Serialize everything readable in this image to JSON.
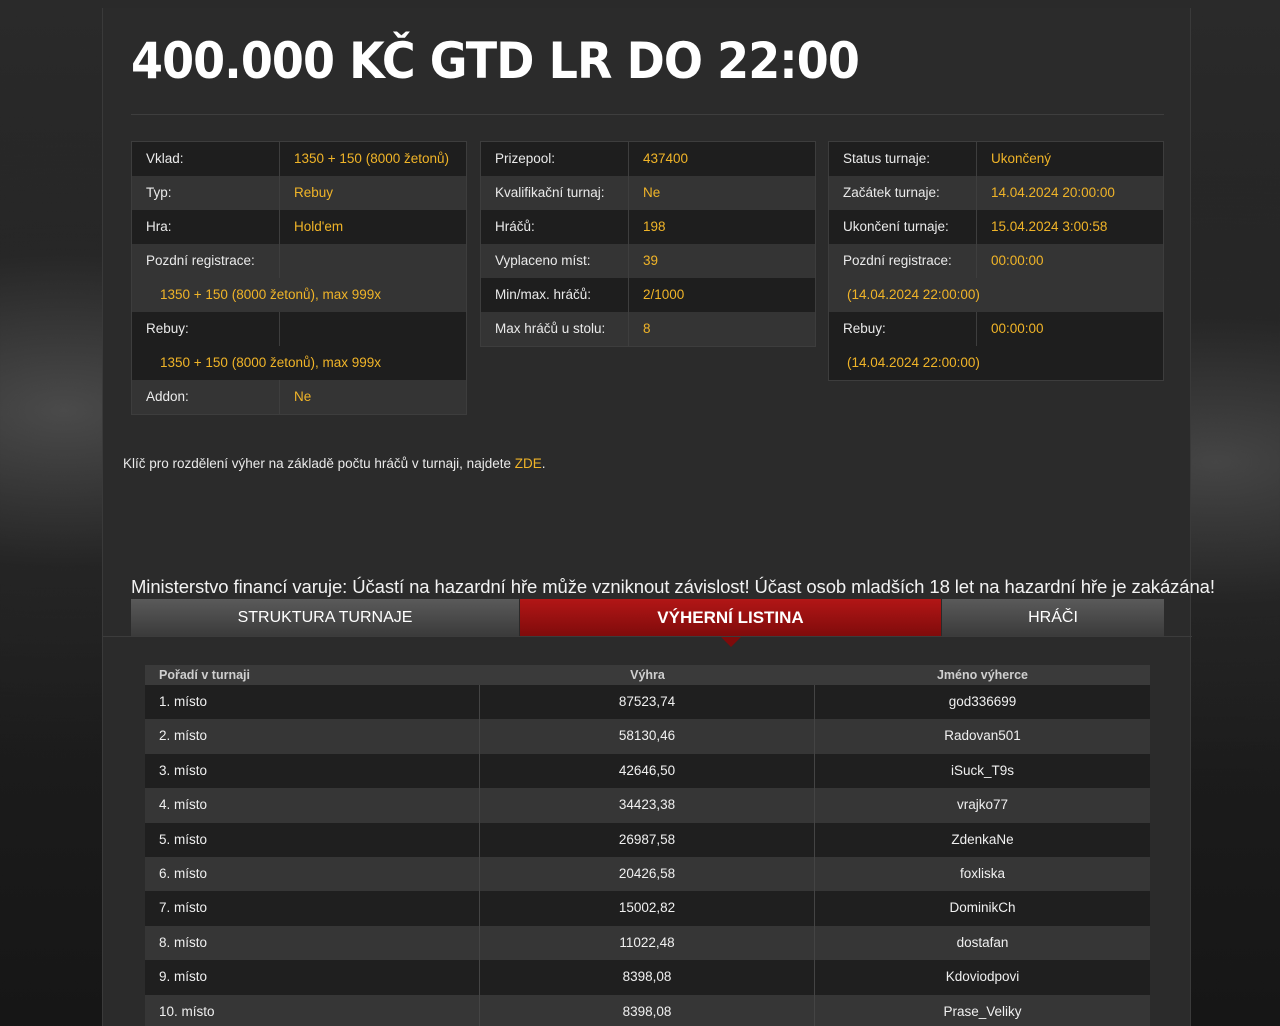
{
  "title": "400.000 KČ GTD LR DO 22:00",
  "info_left": {
    "vklad_label": "Vklad:",
    "vklad_value": "1350 + 150 (8000 žetonů)",
    "typ_label": "Typ:",
    "typ_value": "Rebuy",
    "hra_label": "Hra:",
    "hra_value": "Hold'em",
    "late_reg_label": "Pozdní registrace:",
    "late_reg_value": "1350 + 150 (8000 žetonů), max 999x",
    "rebuy_label": "Rebuy:",
    "rebuy_value": "1350 + 150 (8000 žetonů), max 999x",
    "addon_label": "Addon:",
    "addon_value": "Ne"
  },
  "info_mid": {
    "prizepool_label": "Prizepool:",
    "prizepool_value": "437400",
    "kval_label": "Kvalifikační turnaj:",
    "kval_value": "Ne",
    "hracu_label": "Hráčů:",
    "hracu_value": "198",
    "vyplaceno_label": "Vyplaceno míst:",
    "vyplaceno_value": "39",
    "minmax_label": "Min/max. hráčů:",
    "minmax_value": "2/1000",
    "maxstul_label": "Max hráčů u stolu:",
    "maxstul_value": "8"
  },
  "info_right": {
    "status_label": "Status turnaje:",
    "status_value": "Ukončený",
    "start_label": "Začátek turnaje:",
    "start_value": "14.04.2024 20:00:00",
    "end_label": "Ukončení turnaje:",
    "end_value": "15.04.2024 3:00:58",
    "late_reg_label": "Pozdní registrace:",
    "late_reg_value": "00:00:00",
    "late_reg_sub": "(14.04.2024 22:00:00)",
    "rebuy_label": "Rebuy:",
    "rebuy_value": "00:00:00",
    "rebuy_sub": "(14.04.2024 22:00:00)"
  },
  "note": {
    "text": "Klíč pro rozdělení výher na základě počtu hráčů v turnaji, najdete ",
    "link": "ZDE",
    "tail": "."
  },
  "warning": "Ministerstvo financí varuje: Účastí na hazardní hře může vzniknout závislost! Účast osob mladších 18 let na hazardní hře je zakázána!",
  "tabs": {
    "structure": "STRUKTURA TURNAJE",
    "prizes": "VÝHERNÍ LISTINA",
    "players": "HRÁČI"
  },
  "results": {
    "headers": {
      "place": "Pořadí v turnaji",
      "prize": "Výhra",
      "winner": "Jméno výherce"
    },
    "rows": [
      {
        "place": "1. místo",
        "prize": "87523,74",
        "winner": "god336699"
      },
      {
        "place": "2. místo",
        "prize": "58130,46",
        "winner": "Radovan501"
      },
      {
        "place": "3. místo",
        "prize": "42646,50",
        "winner": "iSuck_T9s"
      },
      {
        "place": "4. místo",
        "prize": "34423,38",
        "winner": "vrajko77"
      },
      {
        "place": "5. místo",
        "prize": "26987,58",
        "winner": "ZdenkaNe"
      },
      {
        "place": "6. místo",
        "prize": "20426,58",
        "winner": "foxliska"
      },
      {
        "place": "7. místo",
        "prize": "15002,82",
        "winner": "DominikCh"
      },
      {
        "place": "8. místo",
        "prize": "11022,48",
        "winner": "dostafan"
      },
      {
        "place": "9. místo",
        "prize": "8398,08",
        "winner": "Kdoviodpovi"
      },
      {
        "place": "10. místo",
        "prize": "8398,08",
        "winner": "Prase_Veliky"
      }
    ]
  }
}
